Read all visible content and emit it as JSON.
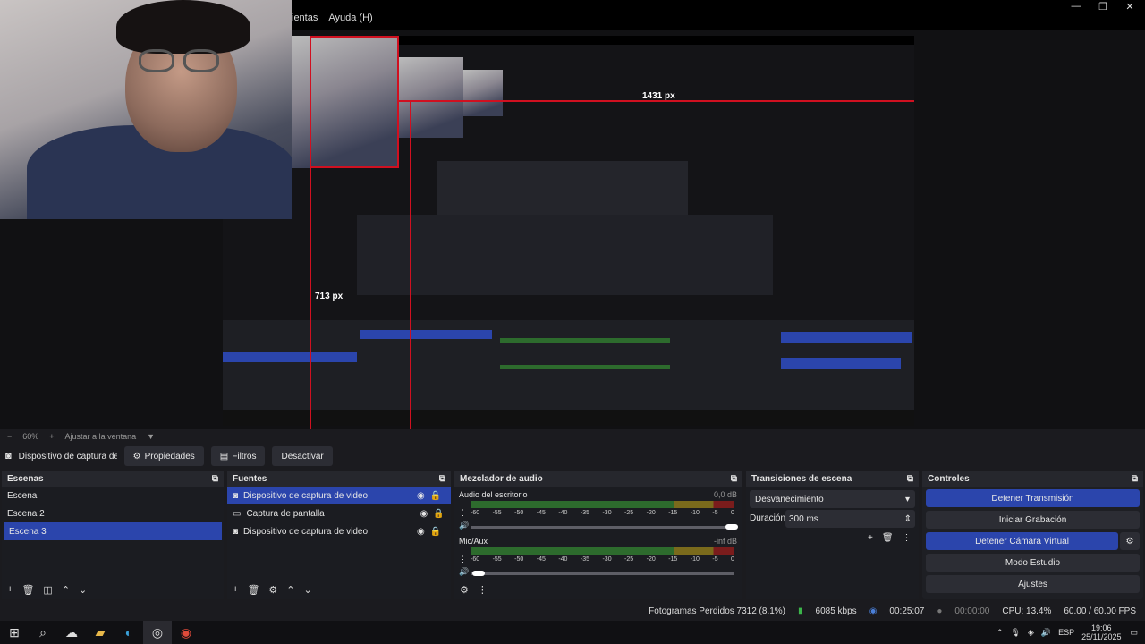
{
  "menu": {
    "tools": "ientas",
    "help": "Ayuda (H)"
  },
  "preview": {
    "label_width": "1431 px",
    "label_height": "713 px"
  },
  "zoom": {
    "minus": "−",
    "level": "60%",
    "plus": "+",
    "fit": "Ajustar a la ventana",
    "caret": "▼"
  },
  "source_toolbar": {
    "source_name": "Dispositivo de captura de v",
    "properties": "Propiedades",
    "filters": "Filtros",
    "deactivate": "Desactivar"
  },
  "scenes": {
    "title": "Escenas",
    "items": [
      "Escena",
      "Escena 2",
      "Escena 3"
    ]
  },
  "sources": {
    "title": "Fuentes",
    "items": [
      "Dispositivo de captura de video",
      "Captura de pantalla",
      "Dispositivo de captura de video"
    ]
  },
  "mixer": {
    "title": "Mezclador de audio",
    "channels": [
      {
        "name": "Audio del escritorio",
        "level": "0,0 dB"
      },
      {
        "name": "Mic/Aux",
        "level": "-inf dB"
      }
    ],
    "ticks": [
      "-60",
      "-55",
      "-50",
      "-45",
      "-40",
      "-35",
      "-30",
      "-25",
      "-20",
      "-15",
      "-10",
      "-5",
      "0"
    ]
  },
  "transitions": {
    "title": "Transiciones de escena",
    "selected": "Desvanecimiento",
    "duration_label": "Duración",
    "duration_value": "300 ms"
  },
  "controls": {
    "title": "Controles",
    "stop_stream": "Detener Transmisión",
    "start_record": "Iniciar Grabación",
    "stop_vcam": "Detener Cámara Virtual",
    "studio": "Modo Estudio",
    "settings": "Ajustes"
  },
  "status": {
    "dropped": "Fotogramas Perdidos 7312 (8.1%)",
    "bitrate": "6085 kbps",
    "stream_time": "00:25:07",
    "rec_time": "00:00:00",
    "cpu": "CPU: 13.4%",
    "fps": "60.00 / 60.00 FPS"
  },
  "taskbar": {
    "lang": "ESP",
    "time": "19:06",
    "date": "25/11/2025"
  },
  "colors": {
    "accent": "#2b45ac",
    "bg": "#1b1b1f",
    "guide": "#d01020"
  }
}
